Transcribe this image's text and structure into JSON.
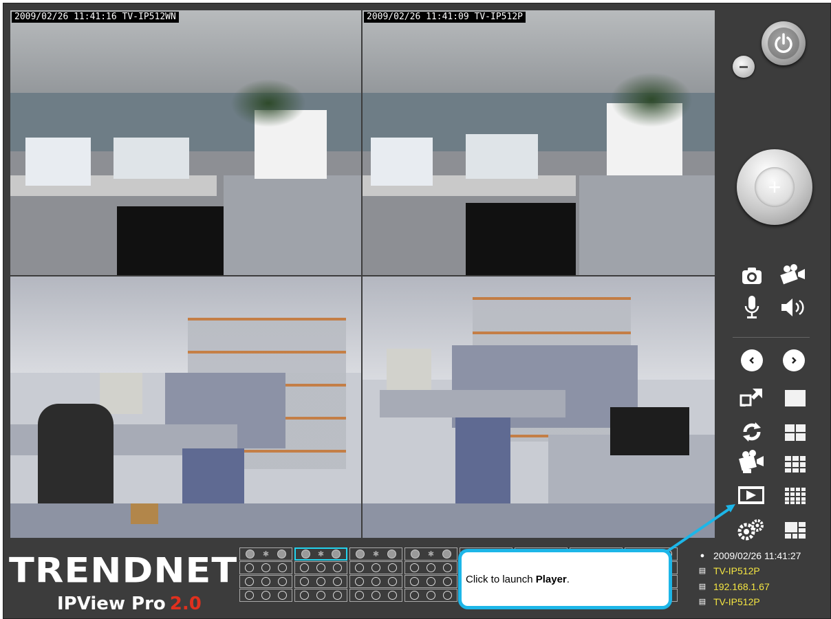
{
  "cameras": [
    {
      "timestamp": "2009/02/26 11:41:16 TV-IP512WN",
      "selected": false
    },
    {
      "timestamp": "2009/02/26 11:41:09 TV-IP512P",
      "selected": true
    },
    {
      "timestamp": "",
      "selected": false
    },
    {
      "timestamp": "",
      "selected": false
    }
  ],
  "branding": {
    "logo": "TRENDNET",
    "product": "IPView Pro",
    "version": "2.0"
  },
  "callout": {
    "text": "Click to launch ",
    "bold": "Player",
    "end": "."
  },
  "status": {
    "datetime": "2009/02/26 11:41:27",
    "camera_name": "TV-IP512P",
    "ip": "192.168.1.67",
    "model": "TV-IP512P"
  },
  "colors": {
    "accent": "#22d3ee",
    "callout_border": "#1db6e8",
    "status_text": "#f5e642",
    "version": "#e0301e"
  },
  "icons": [
    "power-icon",
    "minimize-icon",
    "ptz-dial",
    "snapshot-icon",
    "record-icon",
    "microphone-icon",
    "speaker-icon",
    "prev-icon",
    "next-icon",
    "fullscreen-icon",
    "layout-1-icon",
    "auto-scan-icon",
    "layout-4-icon",
    "playback-icon",
    "layout-9-icon",
    "player-icon",
    "layout-16-icon",
    "settings-icon",
    "layout-custom-icon"
  ]
}
